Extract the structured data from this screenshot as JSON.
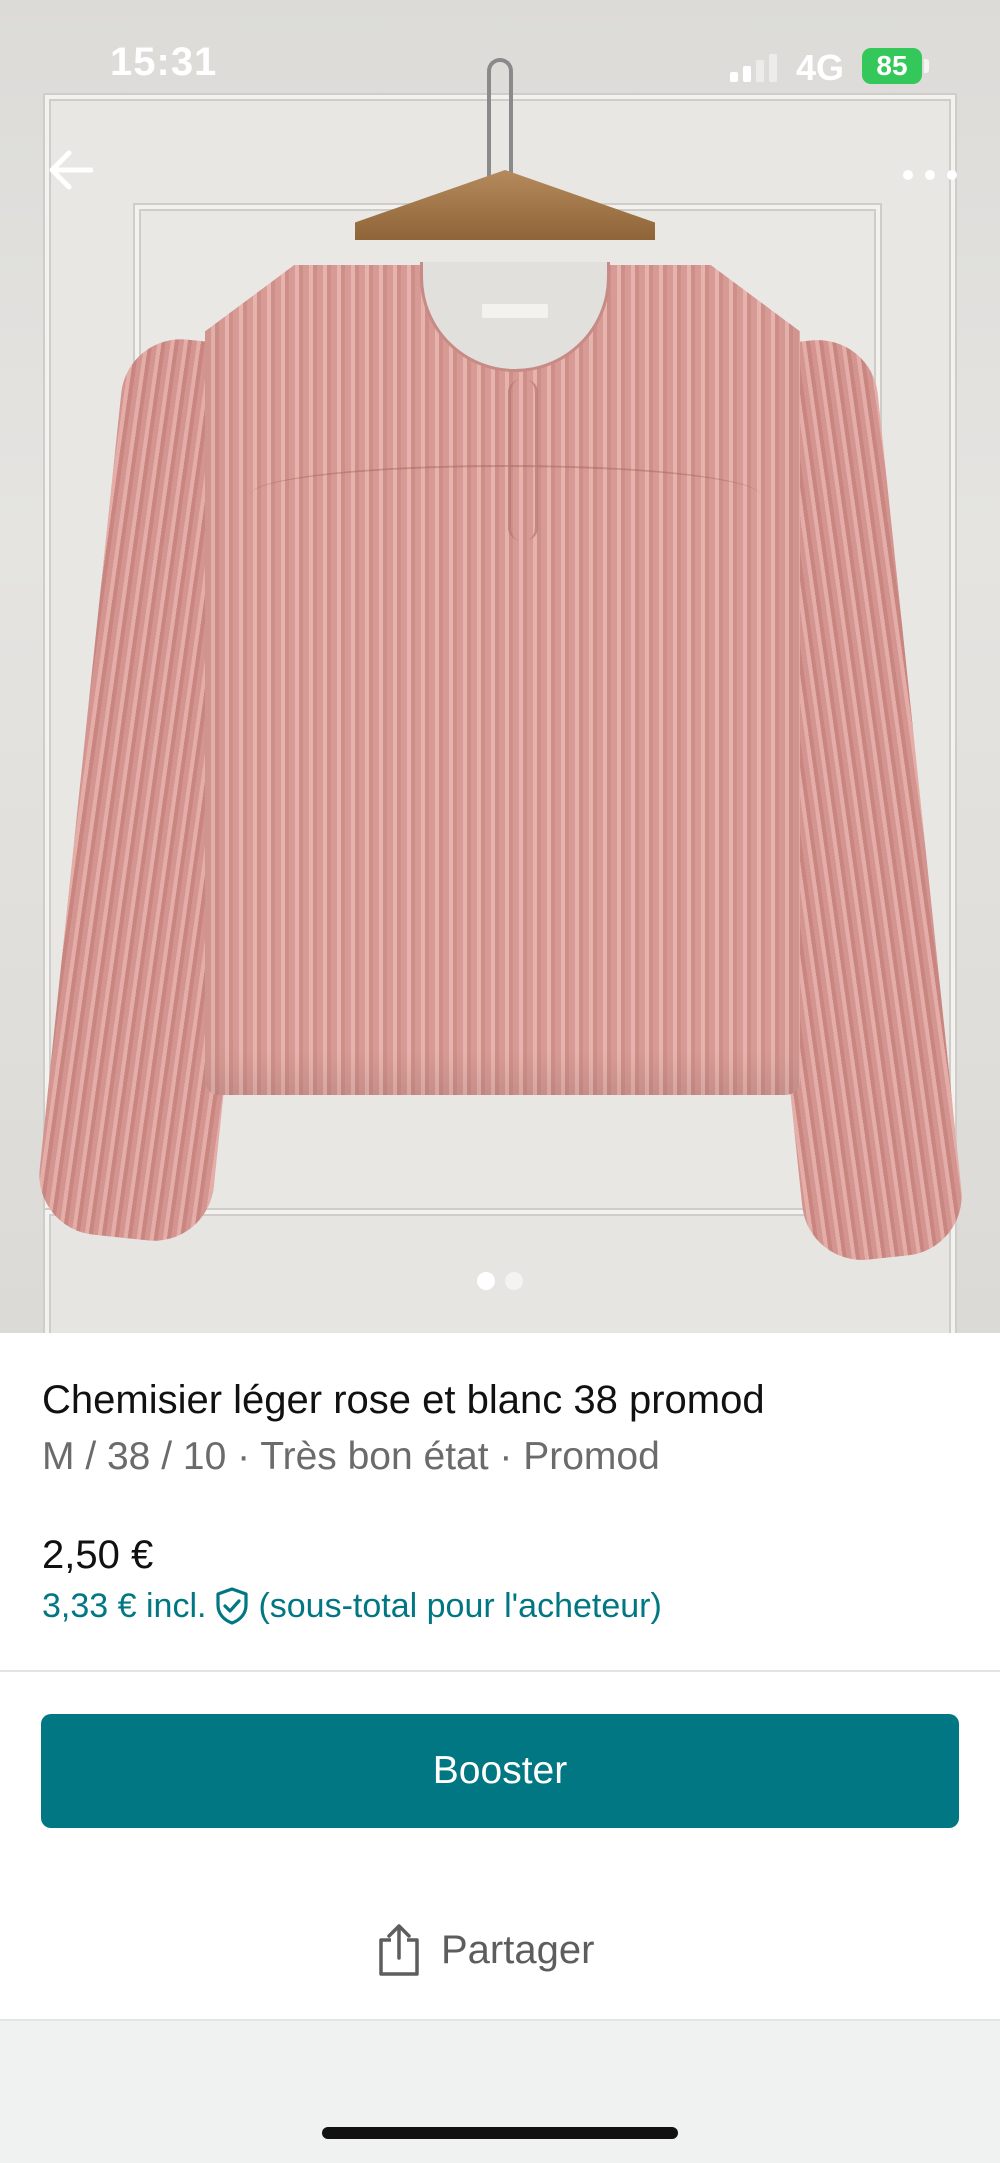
{
  "status_bar": {
    "time": "15:31",
    "network": "4G",
    "battery": "85"
  },
  "nav": {
    "back_icon": "arrow-left-icon",
    "more_icon": "more-horizontal-icon"
  },
  "gallery": {
    "image_count": 2,
    "active_index": 0
  },
  "item": {
    "title": "Chemisier léger rose et blanc 38 promod",
    "meta": "M / 38 / 10 · Très bon état · Promod",
    "price": "2,50 €",
    "price_incl_prefix": "3,33 € incl.",
    "price_incl_suffix": "(sous-total pour l'acheteur)"
  },
  "actions": {
    "booster_label": "Booster",
    "share_label": "Partager"
  },
  "colors": {
    "accent": "#007782",
    "battery": "#34c759"
  }
}
